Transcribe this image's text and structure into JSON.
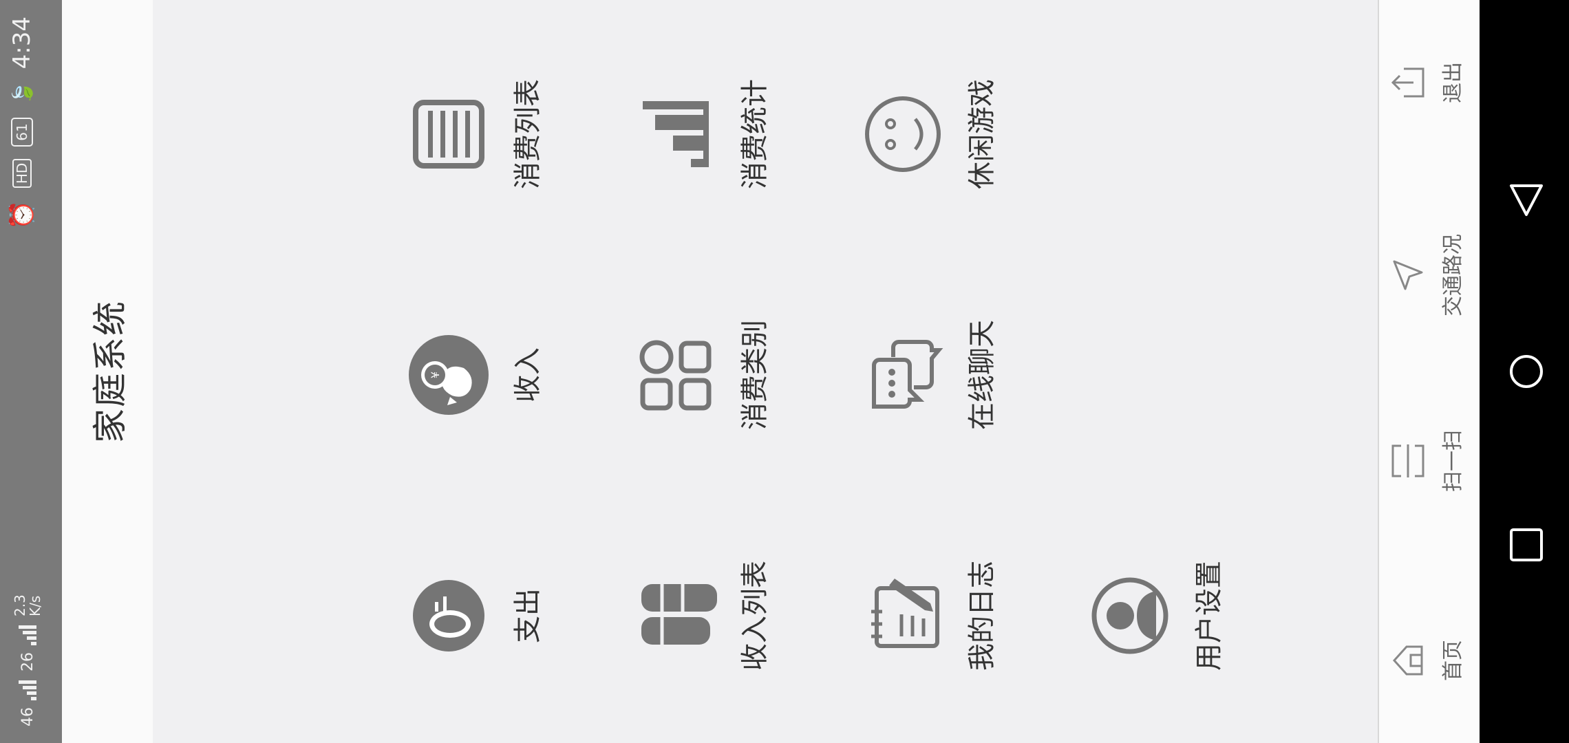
{
  "status_bar": {
    "signal1": "46",
    "signal2": "26",
    "speed": "2.3",
    "speed_unit": "K/s",
    "hd": "HD",
    "battery": "61",
    "time": "4:34"
  },
  "header": {
    "title": "家庭系统"
  },
  "menu": {
    "items": [
      {
        "label": "支出",
        "icon": "coin-stack-icon"
      },
      {
        "label": "收入",
        "icon": "money-bag-icon"
      },
      {
        "label": "消费列表",
        "icon": "list-icon"
      },
      {
        "label": "收入列表",
        "icon": "stacked-coins-icon"
      },
      {
        "label": "消费类别",
        "icon": "category-icon"
      },
      {
        "label": "消费统计",
        "icon": "bar-chart-icon"
      },
      {
        "label": "我的日志",
        "icon": "notebook-icon"
      },
      {
        "label": "在线聊天",
        "icon": "chat-icon"
      },
      {
        "label": "休闲游戏",
        "icon": "smiley-icon"
      },
      {
        "label": "用户设置",
        "icon": "user-icon"
      }
    ]
  },
  "bottom_nav": {
    "items": [
      {
        "label": "首页",
        "icon": "home-icon"
      },
      {
        "label": "扫一扫",
        "icon": "scan-icon"
      },
      {
        "label": "交通路况",
        "icon": "navigation-arrow-icon"
      },
      {
        "label": "退出",
        "icon": "exit-icon"
      }
    ]
  },
  "colors": {
    "icon": "#757575",
    "text": "#333333",
    "status_bar": "#7a7a7a",
    "panel": "#f0f0f2"
  }
}
